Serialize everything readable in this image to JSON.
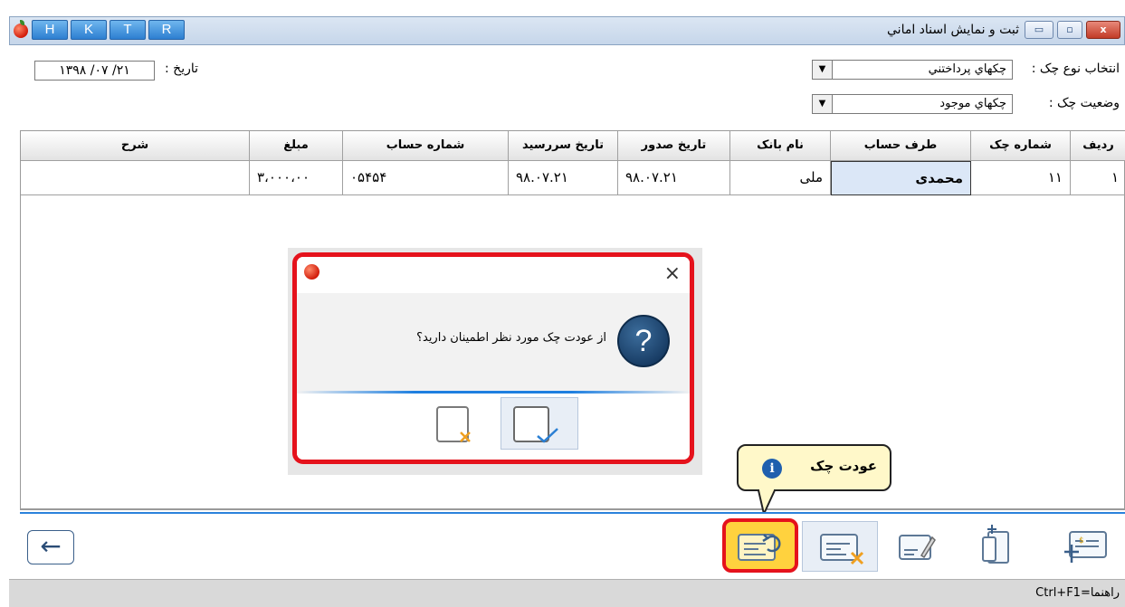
{
  "window": {
    "title": "ثبت و نمايش اسناد اماني",
    "quick_buttons": [
      "H",
      "K",
      "T",
      "R"
    ],
    "close_glyph": "x",
    "max_glyph": "▫",
    "min_glyph": "▭"
  },
  "header": {
    "check_type_label": "انتخاب نوع چک :",
    "check_type_value": "چکهاي پرداختني",
    "check_status_label": "وضعيت چک     :",
    "check_status_value": "چکهاي موجود",
    "date_label": "تاريخ   :",
    "date_value": "۱۳۹۸ /۰۷ /۲۱"
  },
  "table": {
    "columns": [
      "رديف",
      "شماره چک",
      "طرف حساب",
      "نام بانک",
      "تاريخ صدور",
      "تاريخ سررسيد",
      "شماره حساب",
      "مبلغ",
      "شرح"
    ],
    "rows": [
      {
        "row": "۱",
        "check_no": "۱۱",
        "party": "محمدی",
        "bank": "ملی",
        "issue_date": "۹۸.۰۷.۲۱",
        "due_date": "۹۸.۰۷.۲۱",
        "account": "۰۵۴۵۴",
        "amount": "۳،۰۰۰،۰۰",
        "desc": ""
      }
    ]
  },
  "dialog": {
    "message": "از عودت چک مورد نظر اطمينان داريد؟",
    "icon": "question-icon",
    "close_glyph": "×",
    "ok_icon": "document-check-icon",
    "cancel_icon": "document-cancel-icon"
  },
  "tooltip": {
    "text": "عودت چک",
    "icon": "info-icon"
  },
  "toolbar": {
    "back_glyph": "←",
    "items": [
      "return-check",
      "cancel-check",
      "edit-check",
      "transfer-check",
      "new-check"
    ]
  },
  "status": {
    "text": "Ctrl+F1=راهنما"
  },
  "colors": {
    "highlight": "#e5121c",
    "accent": "#2a82dc",
    "tooltip_bg": "#fff8c9",
    "selected_cell": "#dbe7f7"
  }
}
